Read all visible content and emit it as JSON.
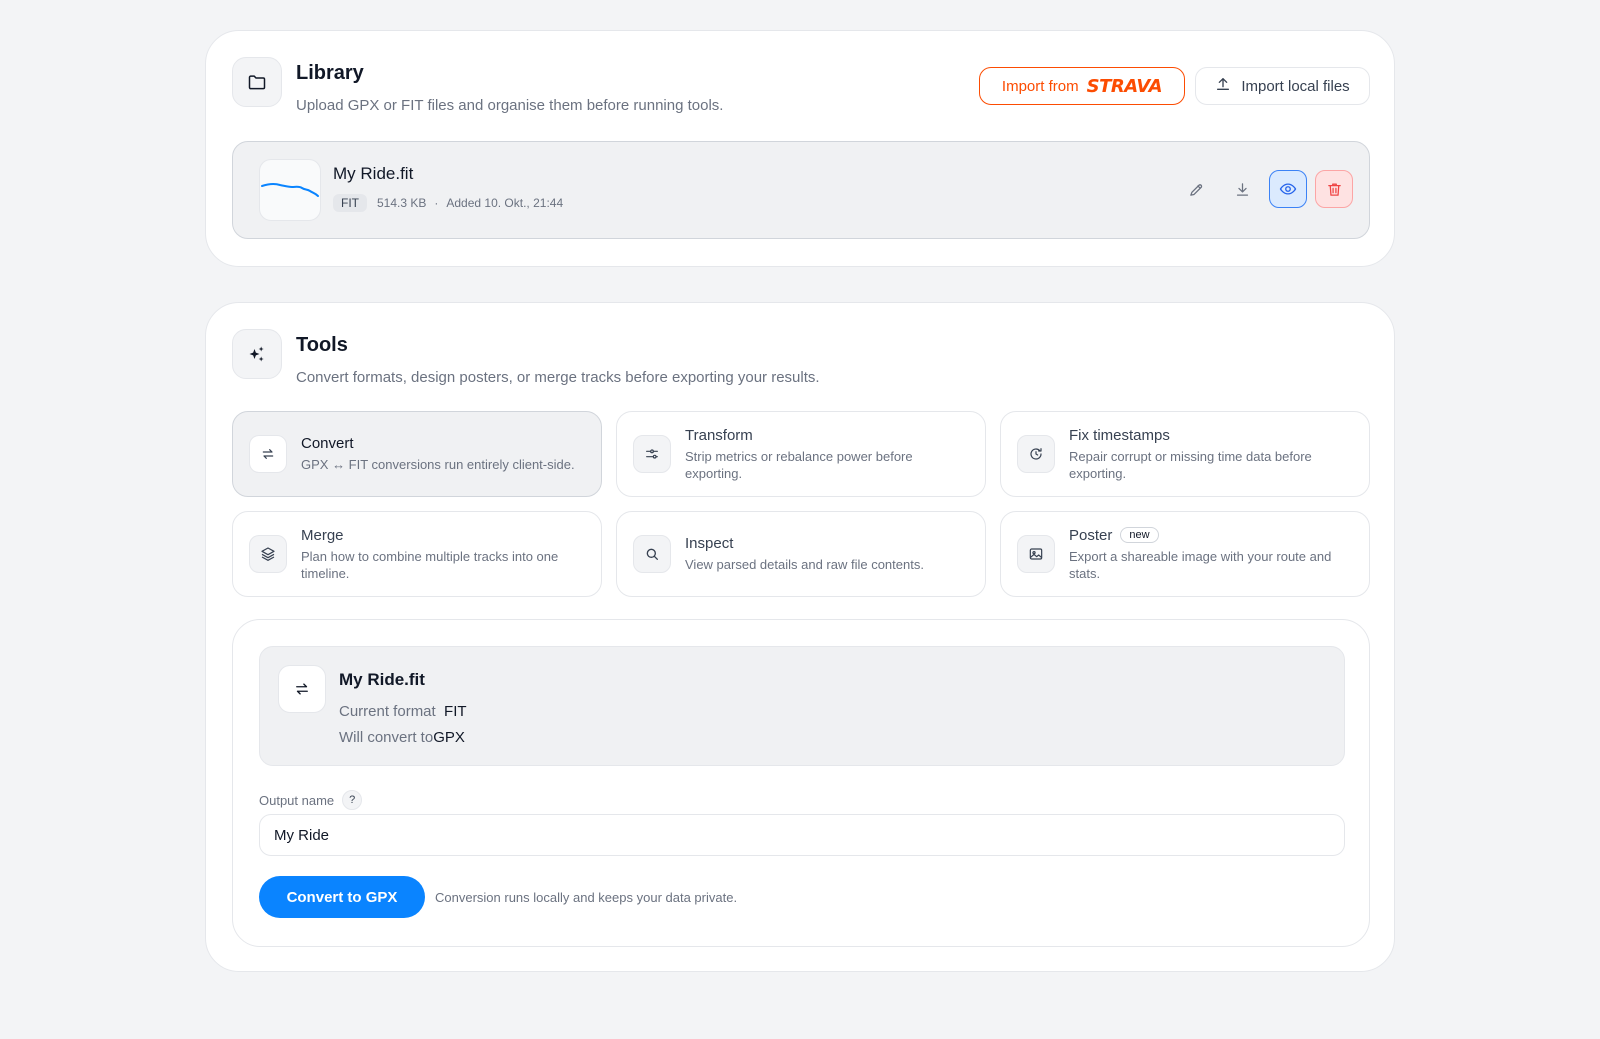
{
  "library": {
    "title": "Library",
    "subtitle": "Upload GPX or FIT files and organise them before running tools.",
    "import_strava_prefix": "Import from",
    "import_strava_brand": "STRAVA",
    "import_local_label": "Import local files",
    "files": [
      {
        "name": "My Ride.fit",
        "type": "FIT",
        "size": "514.3 KB",
        "separator": "·",
        "added": "Added 10. Okt., 21:44"
      }
    ]
  },
  "tools": {
    "title": "Tools",
    "subtitle": "Convert formats, design posters, or merge tracks before exporting your results.",
    "items": [
      {
        "title": "Convert",
        "description": "GPX ↔ FIT conversions run entirely client-side.",
        "icon": "arrows-swap-icon",
        "active": true
      },
      {
        "title": "Transform",
        "description": "Strip metrics or rebalance power before exporting.",
        "icon": "sliders-icon"
      },
      {
        "title": "Fix timestamps",
        "description": "Repair corrupt or missing time data before exporting.",
        "icon": "clock-refresh-icon"
      },
      {
        "title": "Merge",
        "description": "Plan how to combine multiple tracks into one timeline.",
        "icon": "layers-icon"
      },
      {
        "title": "Inspect",
        "description": "View parsed details and raw file contents.",
        "icon": "search-icon"
      },
      {
        "title": "Poster",
        "badge": "new",
        "description": "Export a shareable image with your route and stats.",
        "icon": "image-icon"
      }
    ]
  },
  "convert": {
    "file_name": "My Ride.fit",
    "current_format_label": "Current format",
    "current_format": "FIT",
    "will_convert_label": "Will convert to",
    "target_format": "GPX",
    "output_label": "Output name",
    "help_glyph": "?",
    "output_value": "My Ride",
    "button_label": "Convert to GPX",
    "hint": "Conversion runs locally and keeps your data private."
  },
  "colors": {
    "accent": "#0a84ff",
    "strava": "#fc4c02",
    "danger": "#ef4444",
    "view": "#2563eb"
  }
}
